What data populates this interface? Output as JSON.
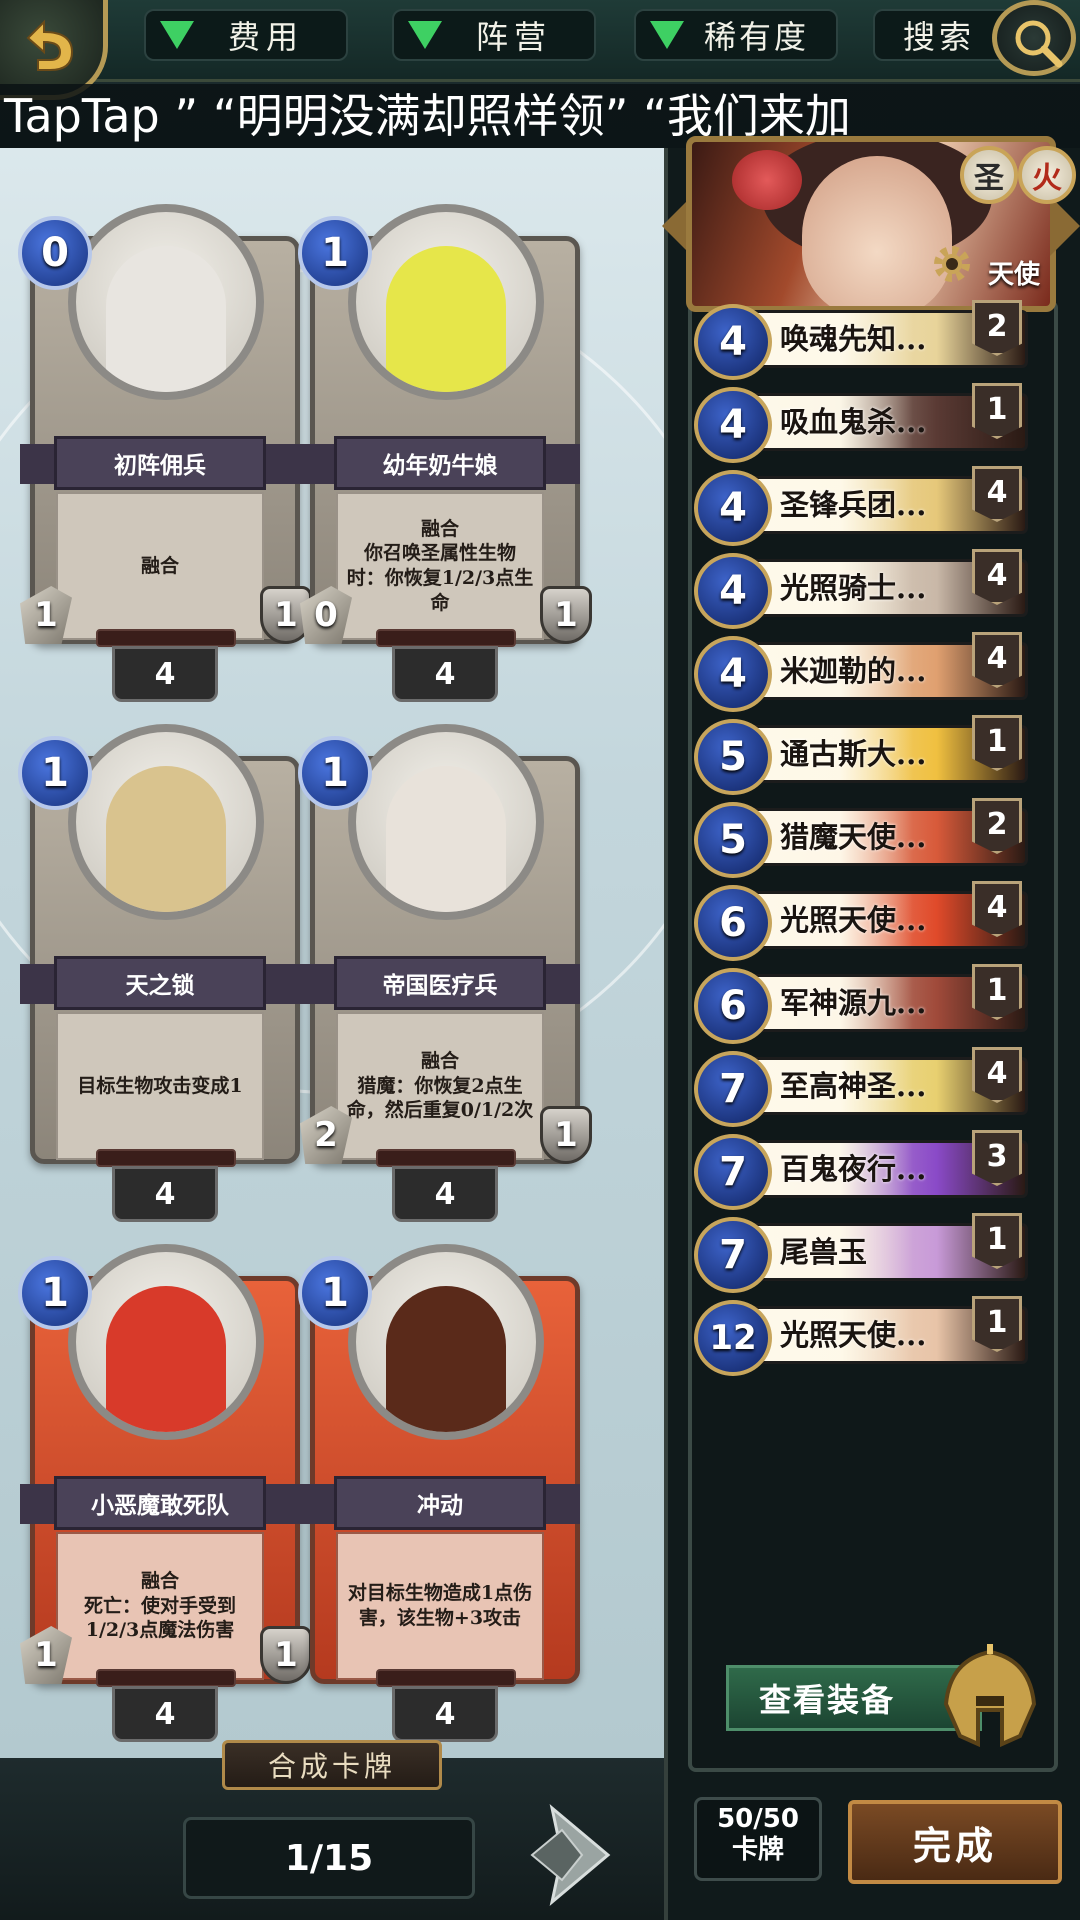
{
  "filters": {
    "cost_label": "费用",
    "faction_label": "阵营",
    "rarity_label": "稀有度",
    "search_label": "搜索"
  },
  "marquee_text": "TapTap ”   “明明没满却照样领”   “我们来加",
  "cards": [
    {
      "name": "初阵佣兵",
      "cost": "0",
      "attack": "1",
      "health": "1",
      "count": "4",
      "description": "融合",
      "theme": "#b8b0a2",
      "art": "#e8e5e0"
    },
    {
      "name": "幼年奶牛娘",
      "cost": "1",
      "attack": "0",
      "health": "1",
      "count": "4",
      "description": "融合\n你召唤圣属性生物时：你恢复1/2/3点生命",
      "theme": "#b8b0a2",
      "art": "#e6e64a"
    },
    {
      "name": "天之锁",
      "cost": "1",
      "attack": "",
      "health": "",
      "count": "4",
      "description": "目标生物攻击变成1",
      "theme": "#b8b0a2",
      "art": "#d9c38e"
    },
    {
      "name": "帝国医疗兵",
      "cost": "1",
      "attack": "2",
      "health": "1",
      "count": "4",
      "description": "融合\n猎魔：你恢复2点生命，然后重复0/1/2次",
      "theme": "#b8b0a2",
      "art": "#e8e2da"
    },
    {
      "name": "小恶魔敢死队",
      "cost": "1",
      "attack": "1",
      "health": "1",
      "count": "4",
      "description": "融合\n死亡：使对手受到1/2/3点魔法伤害",
      "theme": "#e8623a",
      "art": "#d83a2a"
    },
    {
      "name": "冲动",
      "cost": "1",
      "attack": "",
      "health": "",
      "count": "4",
      "description": "对目标生物造成1点伤害，该生物+3攻击",
      "theme": "#e8623a",
      "art": "#5a2a1a"
    }
  ],
  "craft_button": "合成卡牌",
  "pagination": "1/15",
  "hero": {
    "class_label": "天使",
    "badge_holy": "圣",
    "badge_fire": "火"
  },
  "deck": [
    {
      "cost": "4",
      "name": "唤魂先知...",
      "count": "2",
      "color": "#e8d49a"
    },
    {
      "cost": "4",
      "name": "吸血鬼杀...",
      "count": "1",
      "color": "#5a3a34"
    },
    {
      "cost": "4",
      "name": "圣锋兵团...",
      "count": "4",
      "color": "#e6c87a"
    },
    {
      "cost": "4",
      "name": "光照骑士...",
      "count": "4",
      "color": "#c9b8a8"
    },
    {
      "cost": "4",
      "name": "米迦勒的...",
      "count": "4",
      "color": "#e0a070"
    },
    {
      "cost": "5",
      "name": "通古斯大...",
      "count": "1",
      "color": "#f0c040"
    },
    {
      "cost": "5",
      "name": "猎魔天使...",
      "count": "2",
      "color": "#d85a3a"
    },
    {
      "cost": "6",
      "name": "光照天使...",
      "count": "4",
      "color": "#e04a2a"
    },
    {
      "cost": "6",
      "name": "军神源九...",
      "count": "1",
      "color": "#a04a3a"
    },
    {
      "cost": "7",
      "name": "至高神圣...",
      "count": "4",
      "color": "#e8d070"
    },
    {
      "cost": "7",
      "name": "百鬼夜行...",
      "count": "3",
      "color": "#8a4ac8"
    },
    {
      "cost": "7",
      "name": "尾兽玉",
      "count": "1",
      "color": "#c89ad8"
    },
    {
      "cost": "12",
      "name": "光照天使...",
      "count": "1",
      "color": "#e8c4a8"
    }
  ],
  "equip_button": "查看装备",
  "deck_count_value": "50/50",
  "deck_count_label": "卡牌",
  "done_button": "完成"
}
